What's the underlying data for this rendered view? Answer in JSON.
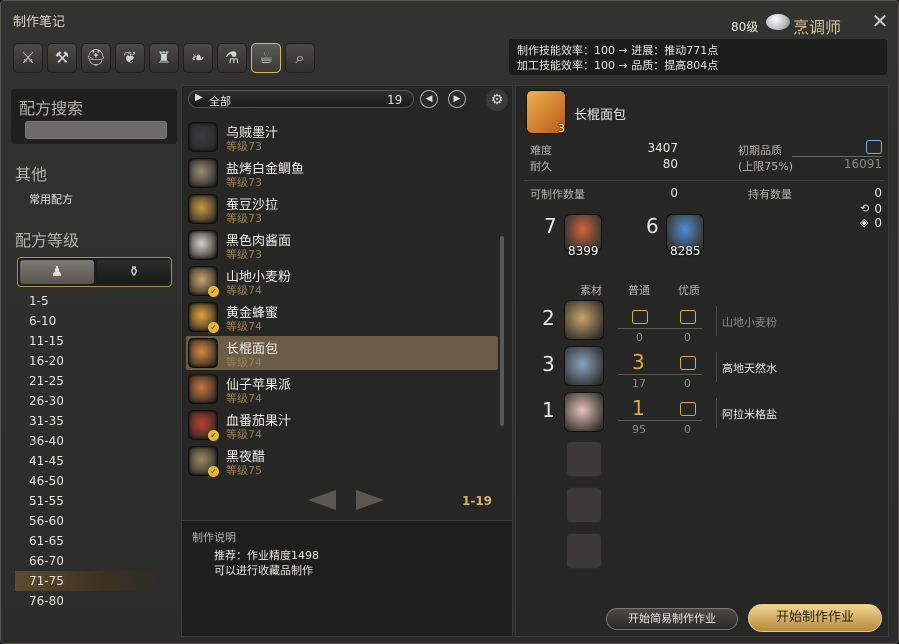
{
  "window": {
    "title": "制作笔记",
    "level": "80级",
    "job": "烹调师"
  },
  "tabs": [
    {
      "icon": "knife-icon",
      "glyph": "⚔"
    },
    {
      "icon": "anvil-icon",
      "glyph": "⚒"
    },
    {
      "icon": "helmet-icon",
      "glyph": "⛑"
    },
    {
      "icon": "necklace-icon",
      "glyph": "❦"
    },
    {
      "icon": "loom-icon",
      "glyph": "♜"
    },
    {
      "icon": "leather-icon",
      "glyph": "❧"
    },
    {
      "icon": "flask-icon",
      "glyph": "⚗"
    },
    {
      "icon": "cooking-icon",
      "glyph": "☕"
    },
    {
      "icon": "search-icon",
      "glyph": "⌕"
    }
  ],
  "stats": {
    "line1": "制作技能效率：100 → 进展：推动771点",
    "line2": "加工技能效率：100 → 品质：提高804点"
  },
  "sidebar": {
    "search_title": "配方搜索",
    "other_title": "其他",
    "common_recipes": "常用配方",
    "recipe_level_title": "配方等级",
    "toggle": [
      "♟",
      "⚱"
    ],
    "levels": [
      "1-5",
      "6-10",
      "11-15",
      "16-20",
      "21-25",
      "26-30",
      "31-35",
      "36-40",
      "41-45",
      "46-50",
      "51-55",
      "56-60",
      "61-65",
      "66-70",
      "71-75",
      "76-80"
    ],
    "selected_level": "71-75"
  },
  "recipe_list": {
    "filter_label": "全部",
    "filter_count": "19",
    "items": [
      {
        "name": "乌贼墨汁",
        "level": "等级73",
        "color": "#3a3c42",
        "check": false
      },
      {
        "name": "盐烤白金鲷鱼",
        "level": "等级73",
        "color": "#9a8b77",
        "check": false
      },
      {
        "name": "蚕豆沙拉",
        "level": "等级73",
        "color": "#c79a45",
        "check": false
      },
      {
        "name": "黑色肉酱面",
        "level": "等级73",
        "color": "#d9d2c9",
        "check": false
      },
      {
        "name": "山地小麦粉",
        "level": "等级74",
        "color": "#c9a46b",
        "check": true
      },
      {
        "name": "黄金蜂蜜",
        "level": "等级74",
        "color": "#e1a43a",
        "check": true
      },
      {
        "name": "长棍面包",
        "level": "等级74",
        "color": "#d98a3c",
        "check": false
      },
      {
        "name": "仙子苹果派",
        "level": "等级74",
        "color": "#c9773a",
        "check": false
      },
      {
        "name": "血番茄果汁",
        "level": "等级74",
        "color": "#b7412c",
        "check": true
      },
      {
        "name": "黑夜醋",
        "level": "等级75",
        "color": "#9a8c60",
        "check": true
      }
    ],
    "selected_index": 6,
    "page_label": "1-19"
  },
  "description": {
    "title": "制作说明",
    "line1": "推荐：作业精度1498",
    "line2": "可以进行收藏品制作"
  },
  "detail": {
    "name": "长棍面包",
    "yield": "3",
    "difficulty_label": "难度",
    "difficulty": "3407",
    "durability_label": "耐久",
    "durability": "80",
    "initial_quality_label": "初期品质",
    "cap_label": "(上限75%)",
    "max_quality": "16091",
    "craftable_label": "可制作数量",
    "craftable": "0",
    "owned_label": "持有数量",
    "owned": "0",
    "owned_hq": "0",
    "owned_collect": "0",
    "crystals": [
      {
        "need": "7",
        "count": "8399",
        "color": "#d4623a"
      },
      {
        "need": "6",
        "count": "8285",
        "color": "#4b8ed9"
      }
    ],
    "material_header": "素材",
    "nq_header": "普通",
    "hq_header": "优质",
    "materials": [
      {
        "need": "2",
        "name": "山地小麦粉",
        "nq": "",
        "hq": "",
        "nq_owned": "0",
        "hq_owned": "0",
        "color": "#c9a46b",
        "dim": true
      },
      {
        "need": "3",
        "name": "高地天然水",
        "nq": "3",
        "hq": "",
        "nq_owned": "17",
        "hq_owned": "0",
        "color": "#8aa4bf",
        "dim": false
      },
      {
        "need": "1",
        "name": "阿拉米格盐",
        "nq": "1",
        "hq": "",
        "nq_owned": "95",
        "hq_owned": "0",
        "color": "#e6c2b7",
        "dim": false
      }
    ],
    "quick_button": "开始简易制作作业",
    "start_button": "开始制作作业"
  }
}
